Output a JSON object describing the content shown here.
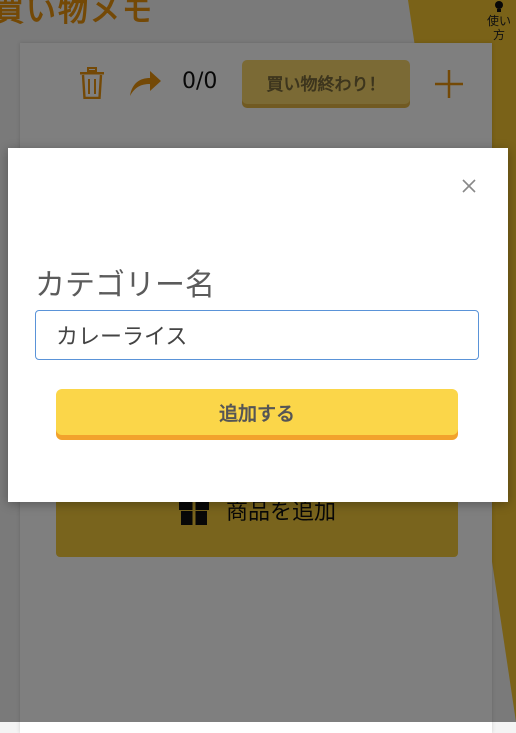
{
  "app": {
    "title": "買い物メモ",
    "help_label": "使い方"
  },
  "toolbar": {
    "counter": "0/0",
    "done_label": "買い物終わり！"
  },
  "list": {
    "add_item_label": "商品を追加"
  },
  "modal": {
    "field_label": "カテゴリー名",
    "input_value": "カレーライス",
    "submit_label": "追加する"
  },
  "colors": {
    "accent_orange": "#e8930c",
    "button_yellow": "#fbd649",
    "input_focus_border": "#5a93d8"
  },
  "icons": [
    "trash-icon",
    "redo-arrow-icon",
    "plus-icon",
    "gift-icon",
    "close-icon",
    "lightbulb-icon"
  ]
}
